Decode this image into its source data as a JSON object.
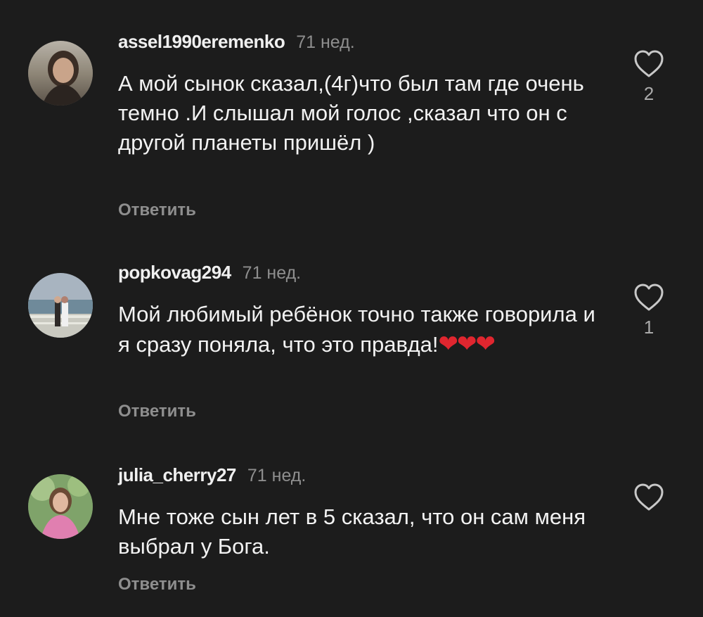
{
  "comments": [
    {
      "username": "assel1990eremenko",
      "time": "71 нед.",
      "text": "А мой сынок сказал,(4г)что был там где очень темно .И слышал мой голос ,сказал что он с другой планеты пришёл )",
      "hearts": "",
      "reply_label": "Ответить",
      "likes": "2",
      "avatar_icon": "user-avatar-photo"
    },
    {
      "username": "popkovag294",
      "time": "71 нед.",
      "text": "Мой любимый ребёнок точно также говорила и я сразу поняла, что это правда!",
      "hearts": "❤❤❤",
      "reply_label": "Ответить",
      "likes": "1",
      "avatar_icon": "user-avatar-photo"
    },
    {
      "username": "julia_cherry27",
      "time": "71 нед.",
      "text": "Мне тоже сын лет в 5 сказал, что он сам меня выбрал у Бога.",
      "hearts": "",
      "reply_label": "Ответить",
      "likes": "",
      "avatar_icon": "user-avatar-photo"
    }
  ],
  "colors": {
    "background": "#1c1c1c",
    "text": "#f2f2f2",
    "secondary": "#8e8e8e",
    "heart_emoji": "#e0262f"
  },
  "icons": {
    "like": "heart-outline-icon"
  }
}
